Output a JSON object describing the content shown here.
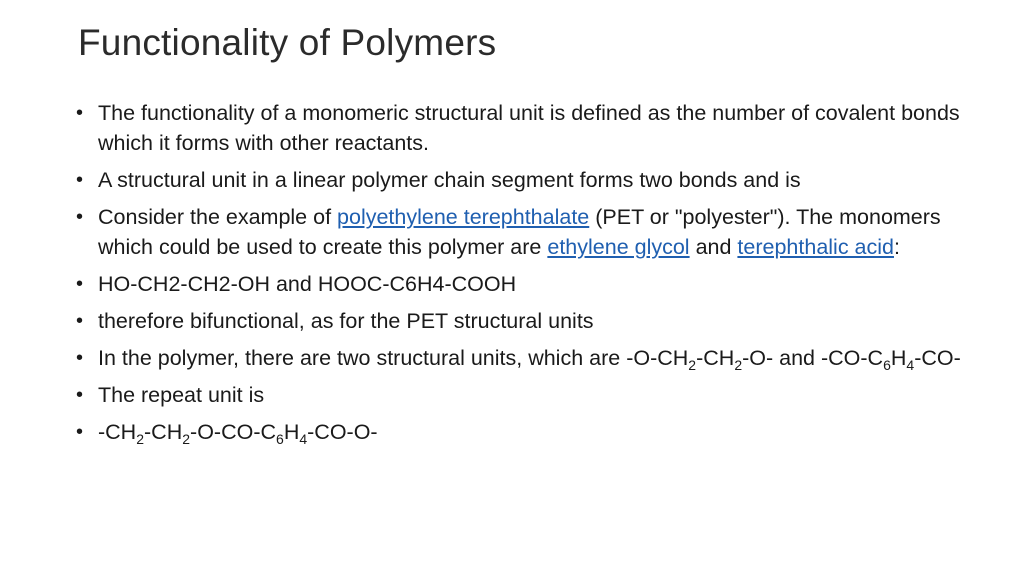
{
  "title": "Functionality of Polymers",
  "bullet_glyph": "•",
  "bullets": {
    "b1": {
      "text": "The functionality of a monomeric structural unit is defined as the number of covalent bonds which it forms with other reactants."
    },
    "b2": {
      "text": "A structural unit in a linear polymer chain segment forms two bonds and is"
    },
    "b3": {
      "t1": "Consider the example of ",
      "link1": "polyethylene terephthalate",
      "t2": " (PET or \"polyester\"). The monomers which could be used to create this polymer are ",
      "link2": "ethylene glycol",
      "t3": " and ",
      "link3": "terephthalic acid",
      "t4": ":"
    },
    "b4": {
      "text": "HO-CH2-CH2-OH and HOOC-C6H4-COOH"
    },
    "b5": {
      "text": "therefore bifunctional, as for the PET structural units"
    },
    "b6": {
      "t1": "In the polymer, there are two structural units, which are -O-CH",
      "s1": "2",
      "t2": "-CH",
      "s2": "2",
      "t3": "-O- and -CO-C",
      "s3": "6",
      "t4": "H",
      "s4": "4",
      "t5": "-CO-"
    },
    "b7": {
      "text": "The repeat unit is"
    },
    "b8": {
      "t1": "-CH",
      "s1": "2",
      "t2": "-CH",
      "s2": "2",
      "t3": "-O-CO-C",
      "s3": "6",
      "t4": "H",
      "s4": "4",
      "t5": "-CO-O-"
    }
  },
  "colors": {
    "text": "#1a1a1a",
    "title": "#2b2b2b",
    "link": "#1f5fb0",
    "background": "#ffffff"
  }
}
